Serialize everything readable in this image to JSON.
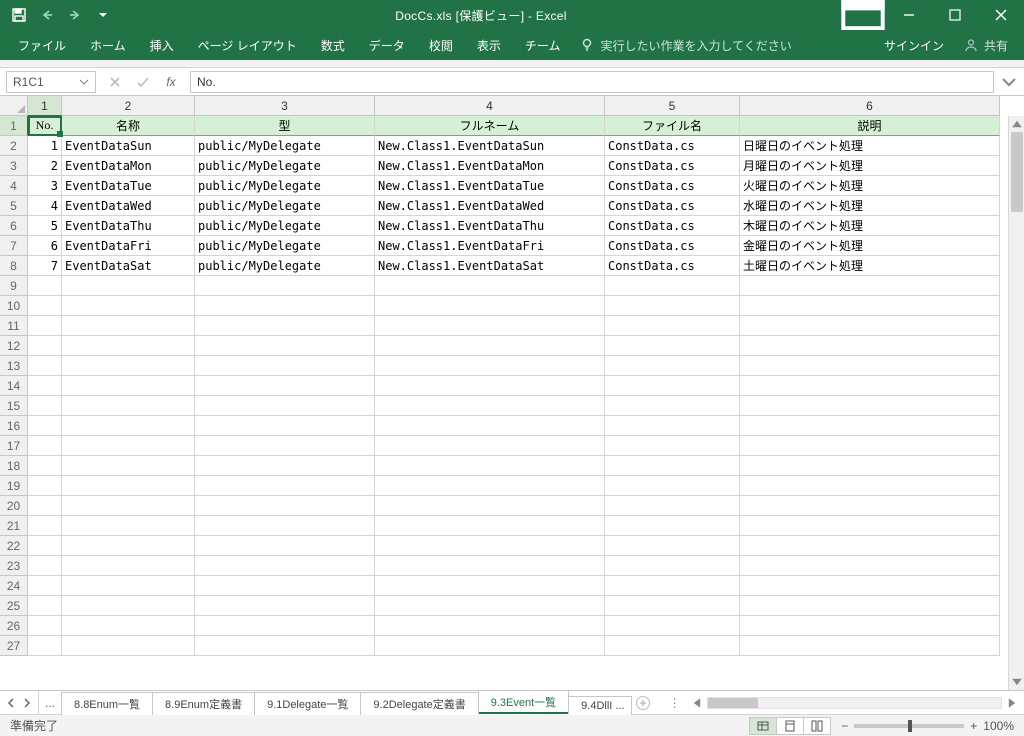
{
  "window": {
    "title": "DocCs.xls  [保護ビュー] - Excel"
  },
  "qat": {
    "save": "保存",
    "undo": "元に戻す",
    "redo": "やり直し",
    "customize": "カスタマイズ"
  },
  "ribbon": {
    "tabs": [
      "ファイル",
      "ホーム",
      "挿入",
      "ページ レイアウト",
      "数式",
      "データ",
      "校閲",
      "表示",
      "チーム"
    ],
    "tellme": "実行したい作業を入力してください",
    "signin": "サインイン",
    "share": "共有"
  },
  "formula_bar": {
    "name_box": "R1C1",
    "formula": "No."
  },
  "columns": [
    "1",
    "2",
    "3",
    "4",
    "5",
    "6"
  ],
  "row_numbers_visible": 27,
  "headers": [
    "No.",
    "名称",
    "型",
    "フルネーム",
    "ファイル名",
    "説明"
  ],
  "rows": [
    {
      "no": "1",
      "name": "EventDataSun",
      "type": "public/MyDelegate",
      "full": "New.Class1.EventDataSun",
      "file": "ConstData.cs",
      "desc": "日曜日のイベント処理"
    },
    {
      "no": "2",
      "name": "EventDataMon",
      "type": "public/MyDelegate",
      "full": "New.Class1.EventDataMon",
      "file": "ConstData.cs",
      "desc": "月曜日のイベント処理"
    },
    {
      "no": "3",
      "name": "EventDataTue",
      "type": "public/MyDelegate",
      "full": "New.Class1.EventDataTue",
      "file": "ConstData.cs",
      "desc": "火曜日のイベント処理"
    },
    {
      "no": "4",
      "name": "EventDataWed",
      "type": "public/MyDelegate",
      "full": "New.Class1.EventDataWed",
      "file": "ConstData.cs",
      "desc": "水曜日のイベント処理"
    },
    {
      "no": "5",
      "name": "EventDataThu",
      "type": "public/MyDelegate",
      "full": "New.Class1.EventDataThu",
      "file": "ConstData.cs",
      "desc": "木曜日のイベント処理"
    },
    {
      "no": "6",
      "name": "EventDataFri",
      "type": "public/MyDelegate",
      "full": "New.Class1.EventDataFri",
      "file": "ConstData.cs",
      "desc": "金曜日のイベント処理"
    },
    {
      "no": "7",
      "name": "EventDataSat",
      "type": "public/MyDelegate",
      "full": "New.Class1.EventDataSat",
      "file": "ConstData.cs",
      "desc": "土曜日のイベント処理"
    }
  ],
  "sheet_tabs": {
    "overflow": "...",
    "tabs": [
      "8.8Enum一覧",
      "8.9Enum定義書",
      "9.1Delegate一覧",
      "9.2Delegate定義書",
      "9.3Event一覧",
      "9.4DllI ..."
    ],
    "active_index": 4
  },
  "status": {
    "ready": "準備完了",
    "zoom": "100%"
  }
}
